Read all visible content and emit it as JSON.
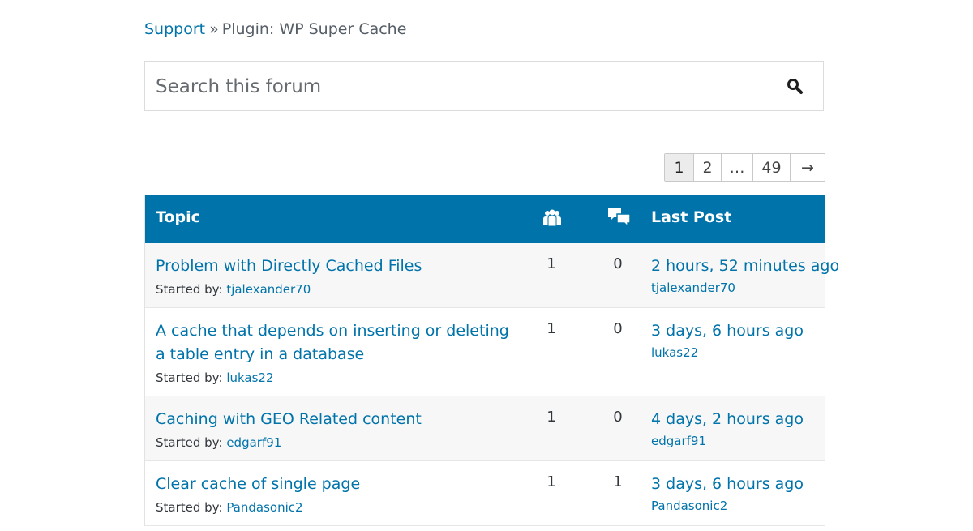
{
  "breadcrumb": {
    "root": "Support",
    "separator": "»",
    "current": "Plugin: WP Super Cache"
  },
  "search": {
    "placeholder": "Search this forum",
    "button_icon": "search-icon"
  },
  "pagination": {
    "pages": [
      "1",
      "2",
      "…",
      "49",
      "→"
    ],
    "current": "1"
  },
  "table": {
    "headers": {
      "topic": "Topic",
      "voices_icon": "voices-icon",
      "posts_icon": "replies-icon",
      "last_post": "Last Post"
    },
    "started_by_label": "Started by:",
    "rows": [
      {
        "title": "Problem with Directly Cached Files",
        "started_by": "tjalexander70",
        "voices": "1",
        "posts": "0",
        "freshness": "2 hours, 52 minutes ago",
        "last_by": "tjalexander70"
      },
      {
        "title": "A cache that depends on inserting or deleting a table entry in a database",
        "started_by": "lukas22",
        "voices": "1",
        "posts": "0",
        "freshness": "3 days, 6 hours ago",
        "last_by": "lukas22"
      },
      {
        "title": "Caching with GEO Related content",
        "started_by": "edgarf91",
        "voices": "1",
        "posts": "0",
        "freshness": "4 days, 2 hours ago",
        "last_by": "edgarf91"
      },
      {
        "title": "Clear cache of single page",
        "started_by": "Pandasonic2",
        "voices": "1",
        "posts": "1",
        "freshness": "3 days, 6 hours ago",
        "last_by": "Pandasonic2"
      }
    ]
  },
  "colors": {
    "accent": "#0073aa",
    "header_text": "#ffffff",
    "row_alt": "#f7f7f7"
  }
}
